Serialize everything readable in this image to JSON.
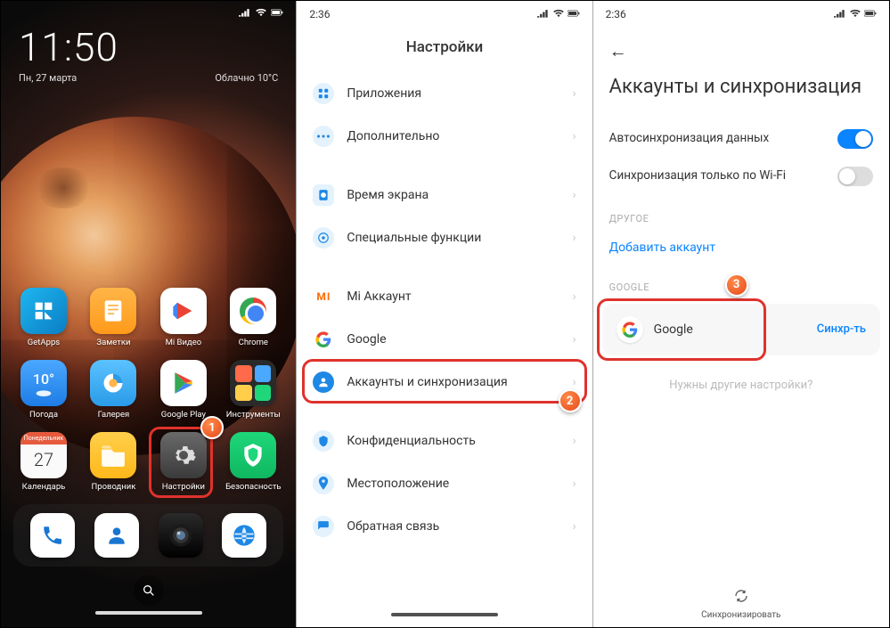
{
  "panel1": {
    "clock": "11:50",
    "date": "Пн, 27 марта",
    "weather_label": "Облачно",
    "weather_temp": "10°C",
    "apps": {
      "r1": [
        {
          "label": "GetApps"
        },
        {
          "label": "Заметки"
        },
        {
          "label": "Mi Видео"
        },
        {
          "label": "Chrome"
        }
      ],
      "r2": [
        {
          "label": "Погода"
        },
        {
          "label": "Галерея"
        },
        {
          "label": "Google Play"
        },
        {
          "label": "Инструменты"
        }
      ],
      "r3": [
        {
          "label": "Календарь",
          "cal_day": "27",
          "cal_dow": "Понедельник"
        },
        {
          "label": "Проводник"
        },
        {
          "label": "Настройки"
        },
        {
          "label": "Безопасность"
        }
      ]
    },
    "weather_tile": "10°"
  },
  "panel2": {
    "status_time": "2:36",
    "title": "Настройки",
    "items": [
      {
        "label": "Приложения"
      },
      {
        "label": "Дополнительно"
      },
      {
        "label": "Время экрана"
      },
      {
        "label": "Специальные функции"
      },
      {
        "label": "Mi Аккаунт"
      },
      {
        "label": "Google"
      },
      {
        "label": "Аккаунты и синхронизация"
      },
      {
        "label": "Конфиденциальность"
      },
      {
        "label": "Местоположение"
      },
      {
        "label": "Обратная связь"
      }
    ]
  },
  "panel3": {
    "status_time": "2:36",
    "title": "Аккаунты и синхронизация",
    "autosync": "Автосинхронизация данных",
    "wifi_only": "Синхронизация только по Wi-Fi",
    "section_other": "ДРУГОЕ",
    "add_account": "Добавить аккаунт",
    "section_google": "GOOGLE",
    "google_label": "Google",
    "sync_button": "Синхр-ть",
    "hint": "Нужны другие настройки?",
    "sync_all": "Синхронизировать"
  },
  "badges": {
    "one": "1",
    "two": "2",
    "three": "3"
  }
}
